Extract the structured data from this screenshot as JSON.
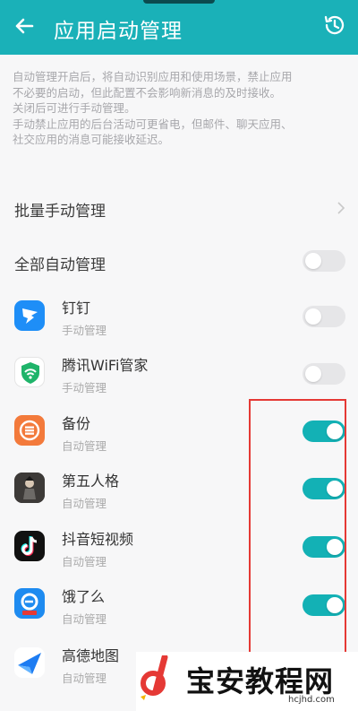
{
  "header": {
    "title": "应用启动管理"
  },
  "description": [
    "自动管理开启后，将自动识别应用和使用场景，禁止应用",
    "不必要的启动，但此配置不会影响新消息的及时接收。",
    "关闭后可进行手动管理。",
    "手动禁止应用的后台活动可更省电，但邮件、聊天应用、",
    "社交应用的消息可能接收延迟。"
  ],
  "batch_manual": {
    "label": "批量手动管理"
  },
  "all_auto": {
    "label": "全部自动管理",
    "enabled": false
  },
  "apps": [
    {
      "name": "钉钉",
      "status": "手动管理",
      "enabled": false,
      "icon": "dingtalk-icon"
    },
    {
      "name": "腾讯WiFi管家",
      "status": "手动管理",
      "enabled": false,
      "icon": "tencent-wifi-icon"
    },
    {
      "name": "备份",
      "status": "自动管理",
      "enabled": true,
      "icon": "backup-icon"
    },
    {
      "name": "第五人格",
      "status": "自动管理",
      "enabled": true,
      "icon": "identity-v-icon"
    },
    {
      "name": "抖音短视频",
      "status": "自动管理",
      "enabled": true,
      "icon": "douyin-icon"
    },
    {
      "name": "饿了么",
      "status": "自动管理",
      "enabled": true,
      "icon": "eleme-icon"
    },
    {
      "name": "高德地图",
      "status": "自动管理",
      "enabled": true,
      "icon": "amap-icon"
    }
  ],
  "watermark": {
    "text": "宝安教程网",
    "url": "hcjhd.com"
  },
  "colors": {
    "accent": "#13b1b5",
    "header": "#1ab1b8",
    "highlight": "#e53935"
  }
}
